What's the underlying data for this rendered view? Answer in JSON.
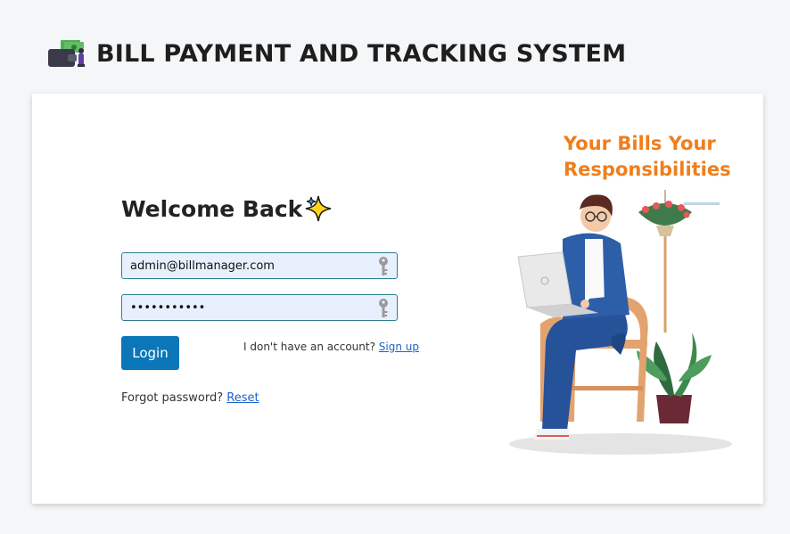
{
  "header": {
    "title": "BILL PAYMENT AND TRACKING SYSTEM",
    "logo_icon": "wallet-icon"
  },
  "login": {
    "heading": "Welcome Back",
    "heading_icon": "sparkle-icon",
    "email_value": "admin@billmanager.com",
    "password_value": "•••••••••••",
    "field_icon": "key-icon",
    "login_label": "Login",
    "no_account_text": "I don't have an account?",
    "signup_link": "Sign up",
    "forgot_text": "Forgot password?",
    "reset_link": "Reset"
  },
  "promo": {
    "tagline": "Your Bills Your Responsibilities",
    "illustration": "person-with-laptop-illustration"
  },
  "colors": {
    "accent": "#0b76b8",
    "tagline": "#f07e1a",
    "field_border": "#2f7f8e",
    "field_bg": "#e8f0fe",
    "link": "#1e63c8"
  }
}
